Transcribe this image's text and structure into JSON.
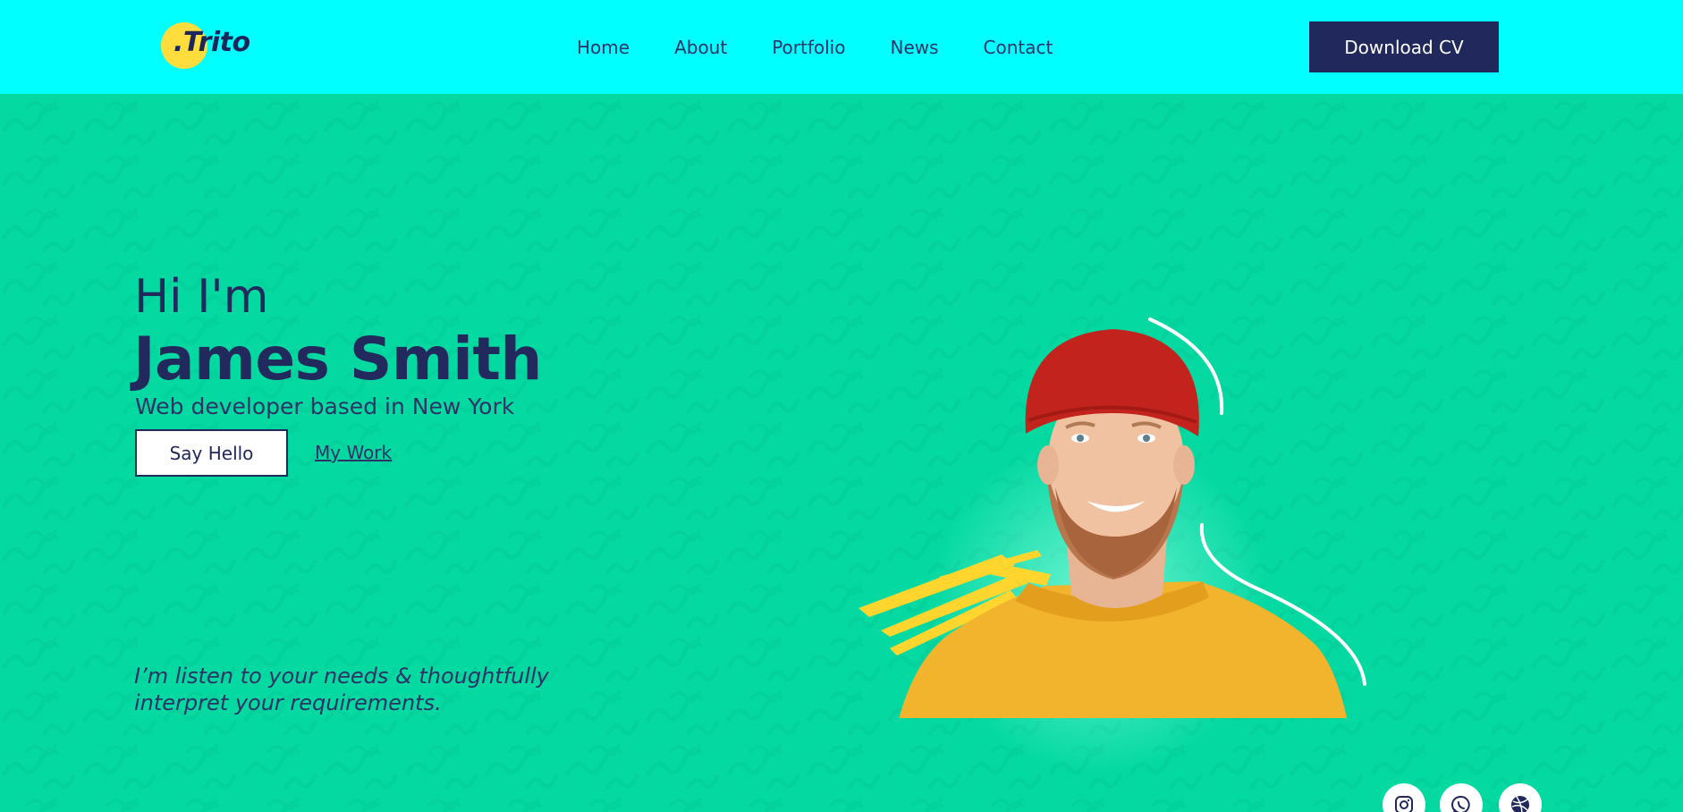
{
  "brand": {
    "logo_text": ".Trito"
  },
  "nav": {
    "items": [
      {
        "label": "Home"
      },
      {
        "label": "About"
      },
      {
        "label": "Portfolio"
      },
      {
        "label": "News"
      },
      {
        "label": "Contact"
      }
    ]
  },
  "header": {
    "cta_label": "Download CV"
  },
  "hero": {
    "greeting": "Hi I'm",
    "name": "James Smith",
    "subtitle": "Web developer based in New York",
    "primary_button": "Say Hello",
    "secondary_link": "My Work",
    "quote_line1": "I’m listen to your needs & thoughtfully",
    "quote_line2": "interpret your requirements."
  },
  "social": {
    "icons": [
      "instagram-icon",
      "whatsapp-icon",
      "dribbble-icon"
    ]
  },
  "colors": {
    "header_bg": "#00ffff",
    "hero_bg": "#05d9a2",
    "navy": "#21285b",
    "logo_yellow": "#ffdd3d",
    "sweater": "#f2b42d",
    "beanie": "#c2241d"
  }
}
